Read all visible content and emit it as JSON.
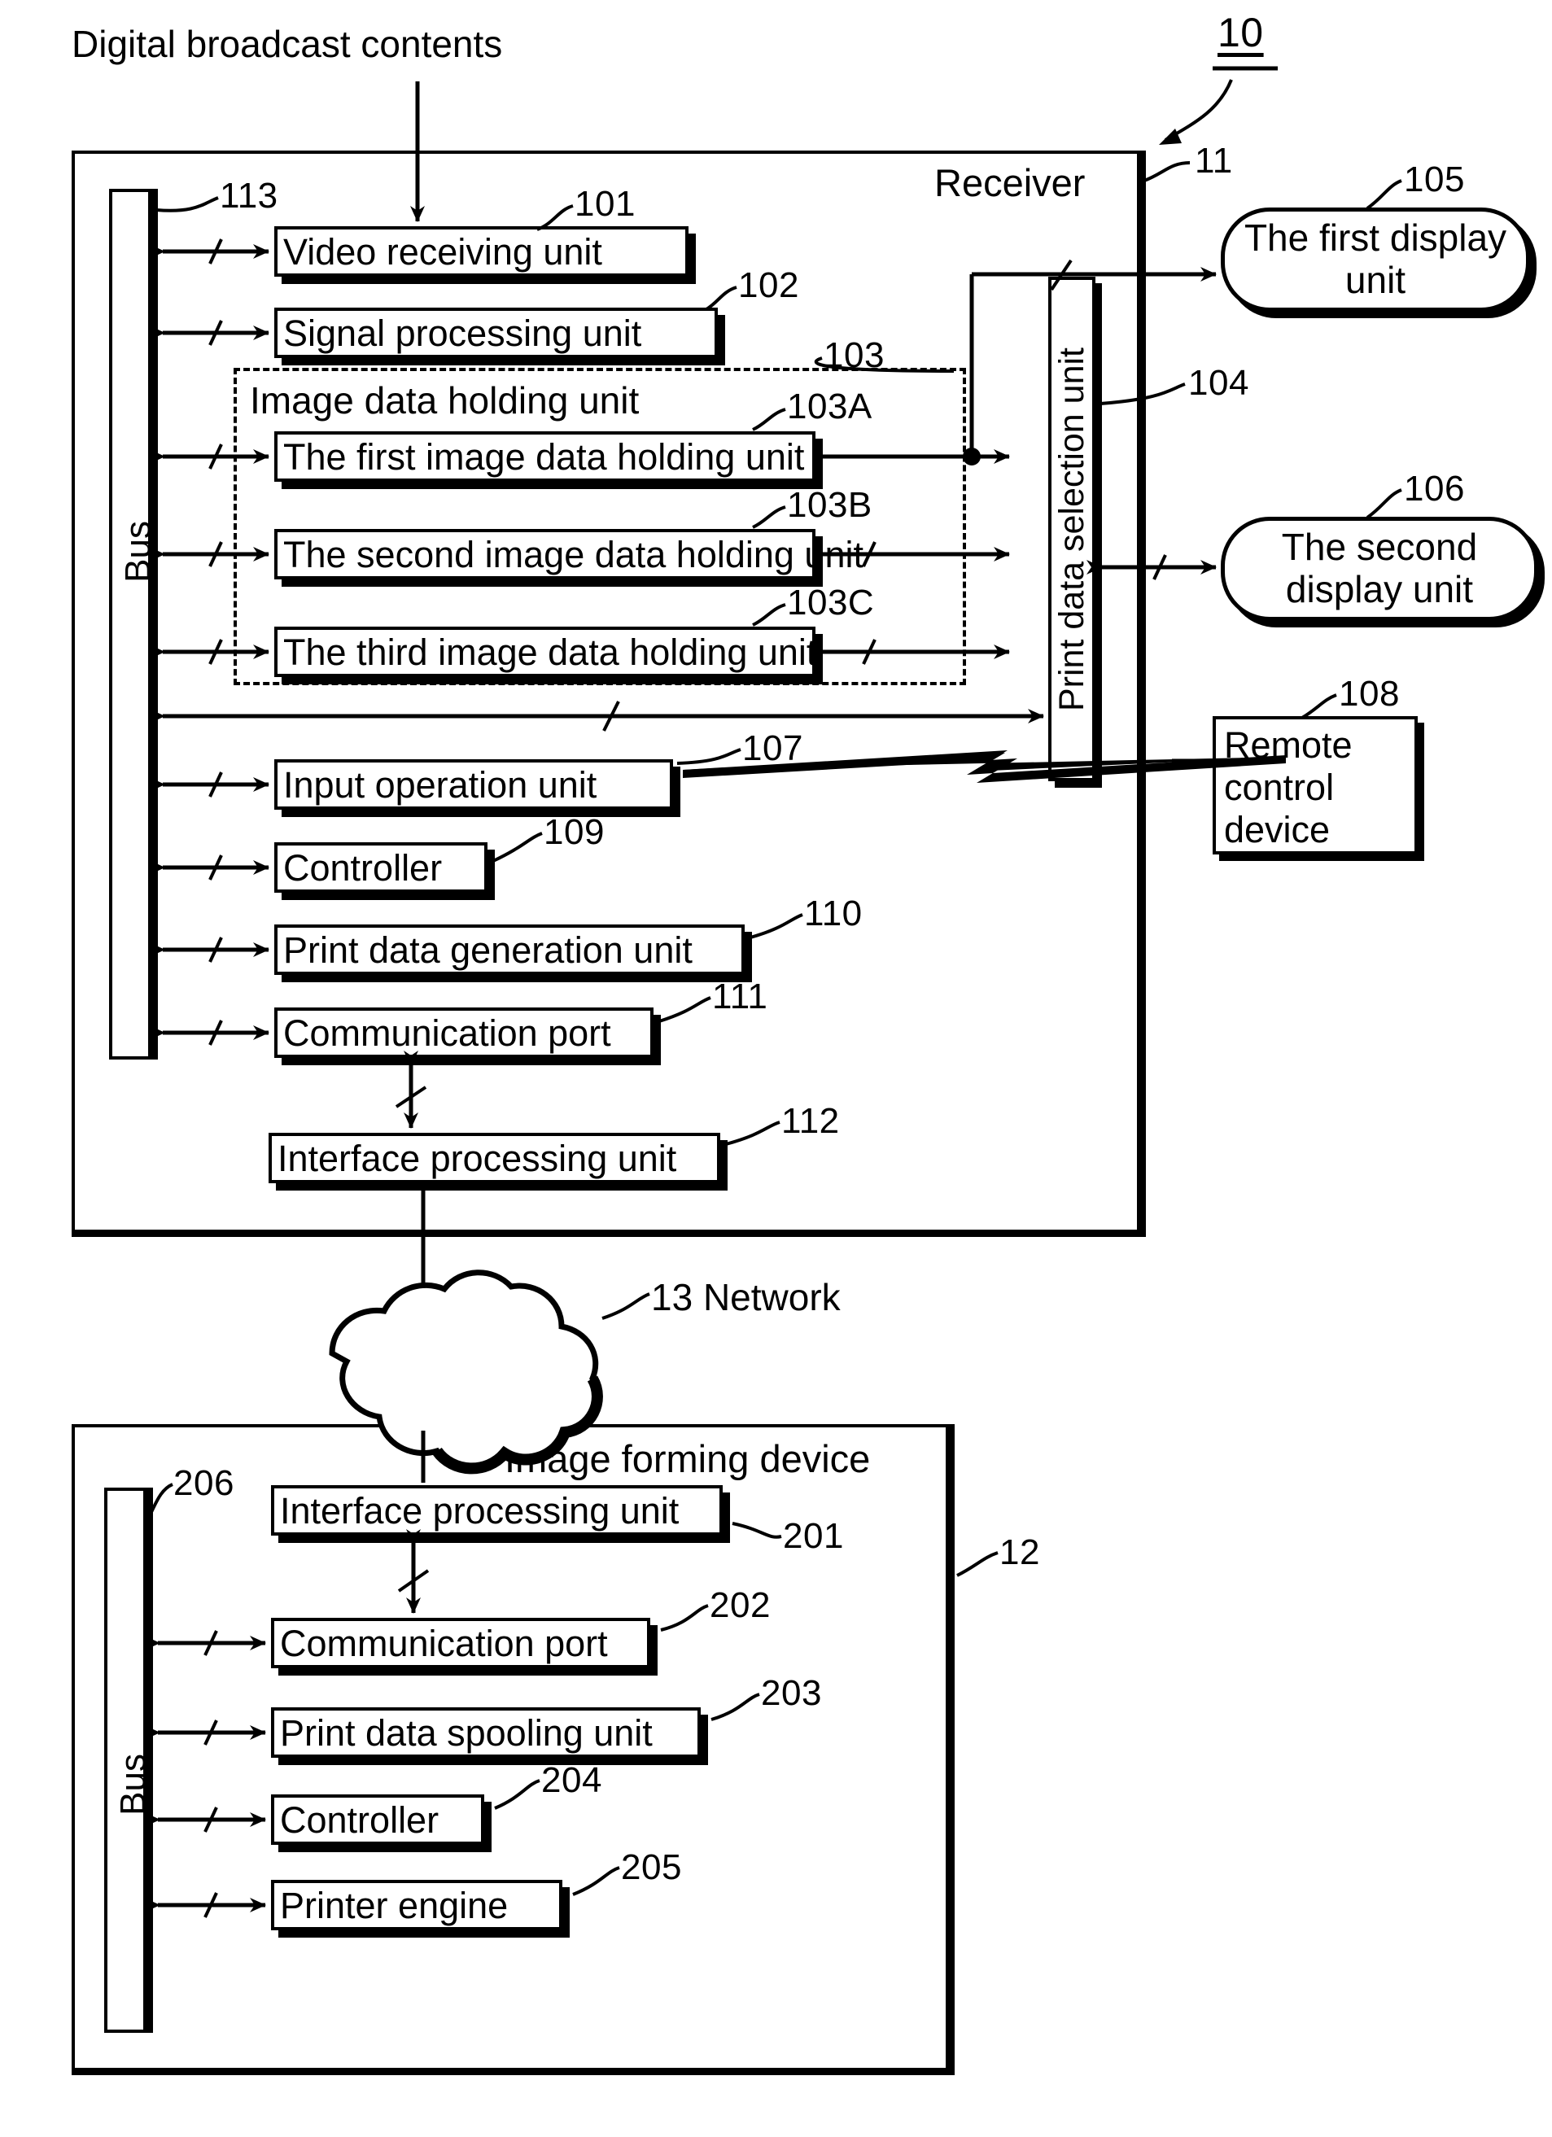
{
  "figure": {
    "system_ref": "10",
    "receiver_ref": "11",
    "image_forming_device_ref": "12",
    "network_ref_label": "13 Network"
  },
  "top_caption": "Digital broadcast contents",
  "receiver": {
    "title": "Receiver",
    "bus_label": "Bus",
    "bus_ref": "113",
    "blocks": [
      {
        "label": "Video receiving unit",
        "ref": "101"
      },
      {
        "label": "Signal processing unit",
        "ref": "102"
      },
      {
        "label": "The first image data holding unit",
        "ref": "103A"
      },
      {
        "label": "The second image data holding unit",
        "ref": "103B"
      },
      {
        "label": "The third image data holding unit",
        "ref": "103C"
      },
      {
        "label": "Input operation unit",
        "ref": "107"
      },
      {
        "label": "Controller",
        "ref": "109"
      },
      {
        "label": "Print data generation unit",
        "ref": "110"
      },
      {
        "label": "Communication port",
        "ref": "111"
      },
      {
        "label": "Interface processing unit",
        "ref": "112"
      }
    ],
    "image_data_holding_unit": {
      "label": "Image data holding unit",
      "ref": "103"
    },
    "print_data_selection_unit": {
      "label": "Print data selection unit",
      "ref": "104"
    }
  },
  "peripherals": [
    {
      "label": "The first display unit",
      "ref": "105"
    },
    {
      "label": "The second display unit",
      "ref": "106"
    },
    {
      "label": "Remote control device",
      "ref": "108",
      "line1": "Remote",
      "line2": "control",
      "line3": "device"
    }
  ],
  "image_forming_device": {
    "title": "Image forming device",
    "bus_label": "Bus",
    "bus_ref": "206",
    "blocks": [
      {
        "label": "Interface processing unit",
        "ref": "201"
      },
      {
        "label": "Communication port",
        "ref": "202"
      },
      {
        "label": "Print data spooling unit",
        "ref": "203"
      },
      {
        "label": "Controller",
        "ref": "204"
      },
      {
        "label": "Printer engine",
        "ref": "205"
      }
    ]
  },
  "colors": {
    "ink": "#000000",
    "paper": "#ffffff"
  }
}
